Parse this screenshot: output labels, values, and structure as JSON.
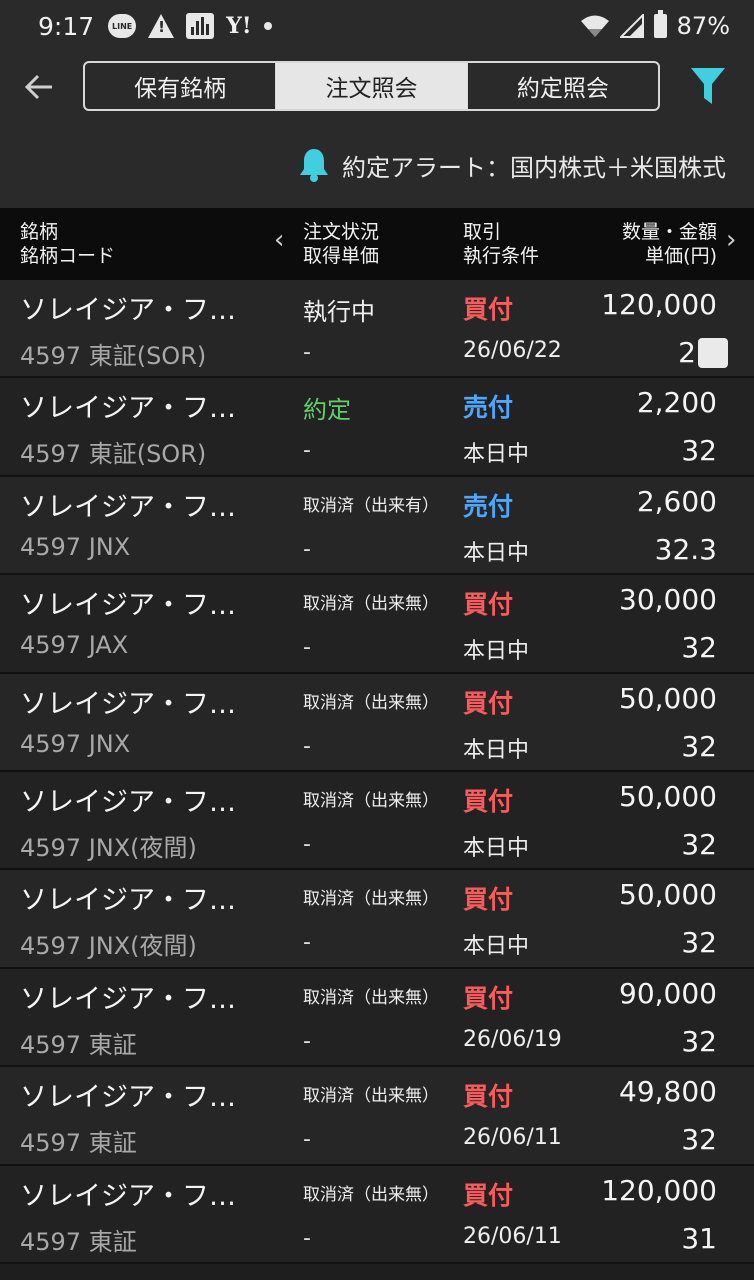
{
  "status_bar": {
    "time": "9:17",
    "line_label": "LINE",
    "yahoo_label": "Y!",
    "battery": "87%"
  },
  "header": {
    "tabs": [
      {
        "label": "保有銘柄",
        "active": false
      },
      {
        "label": "注文照会",
        "active": true
      },
      {
        "label": "約定照会",
        "active": false
      }
    ],
    "filter_color": "#3fd0e0"
  },
  "alert": {
    "text": "約定アラート：国内株式＋米国株式"
  },
  "columns": {
    "col1_line1": "銘柄",
    "col1_line2": "銘柄コード",
    "col2_line1": "注文状況",
    "col2_line2": "取得単価",
    "col3_line1": "取引",
    "col3_line2": "執行条件",
    "col4_line1": "数量・金額",
    "col4_line2": "単価(円)"
  },
  "orders": [
    {
      "name": "ソレイジア・フ…",
      "code": "4597 東証(SOR)",
      "status": "執行中",
      "price": "-",
      "side": "買付",
      "condition": "26/06/22",
      "quantity": "120,000",
      "unit_price": "2"
    },
    {
      "name": "ソレイジア・フ…",
      "code": "4597 東証(SOR)",
      "status": "約定",
      "price": "-",
      "side": "売付",
      "condition": "本日中",
      "quantity": "2,200",
      "unit_price": "32"
    },
    {
      "name": "ソレイジア・フ…",
      "code": "4597 JNX",
      "status": "取消済（出来有）",
      "price": "-",
      "side": "売付",
      "condition": "本日中",
      "quantity": "2,600",
      "unit_price": "32.3"
    },
    {
      "name": "ソレイジア・フ…",
      "code": "4597 JAX",
      "status": "取消済（出来無）",
      "price": "-",
      "side": "買付",
      "condition": "本日中",
      "quantity": "30,000",
      "unit_price": "32"
    },
    {
      "name": "ソレイジア・フ…",
      "code": "4597 JNX",
      "status": "取消済（出来無）",
      "price": "-",
      "side": "買付",
      "condition": "本日中",
      "quantity": "50,000",
      "unit_price": "32"
    },
    {
      "name": "ソレイジア・フ…",
      "code": "4597 JNX(夜間)",
      "status": "取消済（出来無）",
      "price": "-",
      "side": "買付",
      "condition": "本日中",
      "quantity": "50,000",
      "unit_price": "32"
    },
    {
      "name": "ソレイジア・フ…",
      "code": "4597 JNX(夜間)",
      "status": "取消済（出来無）",
      "price": "-",
      "side": "買付",
      "condition": "本日中",
      "quantity": "50,000",
      "unit_price": "32"
    },
    {
      "name": "ソレイジア・フ…",
      "code": "4597 東証",
      "status": "取消済（出来無）",
      "price": "-",
      "side": "買付",
      "condition": "26/06/19",
      "quantity": "90,000",
      "unit_price": "32"
    },
    {
      "name": "ソレイジア・フ…",
      "code": "4597 東証",
      "status": "取消済（出来無）",
      "price": "-",
      "side": "買付",
      "condition": "26/06/11",
      "quantity": "49,800",
      "unit_price": "32"
    },
    {
      "name": "ソレイジア・フ…",
      "code": "4597 東証",
      "status": "取消済（出来無）",
      "price": "-",
      "side": "買付",
      "condition": "26/06/11",
      "quantity": "120,000",
      "unit_price": "31"
    }
  ],
  "colors": {
    "buy": "#ff5a5a",
    "sell": "#4ba8ff",
    "executed": "#5fd068",
    "bell": "#3fd0e0"
  }
}
